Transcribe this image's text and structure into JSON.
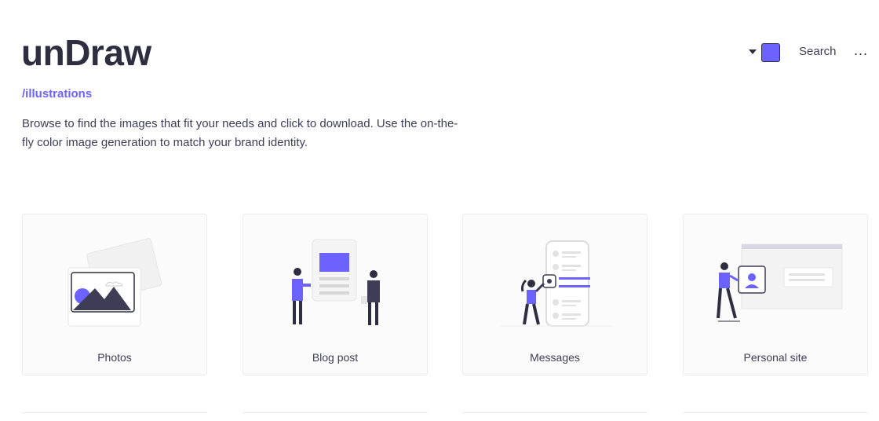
{
  "header": {
    "logo": "unDraw",
    "breadcrumb": "/illustrations",
    "intro": "Browse to find the images that fit your needs and click to download. Use the on-the-fly color image generation to match your brand identity."
  },
  "toolbar": {
    "accent_color": "#6c63ff",
    "search_label": "Search",
    "more_label": "..."
  },
  "cards": [
    {
      "label": "Photos",
      "icon": "photos-illustration"
    },
    {
      "label": "Blog post",
      "icon": "blog-post-illustration"
    },
    {
      "label": "Messages",
      "icon": "messages-illustration"
    },
    {
      "label": "Personal site",
      "icon": "personal-site-illustration"
    }
  ],
  "colors": {
    "accent": "#6c63ff",
    "dark": "#2f2e41",
    "text": "#3f3d56"
  }
}
